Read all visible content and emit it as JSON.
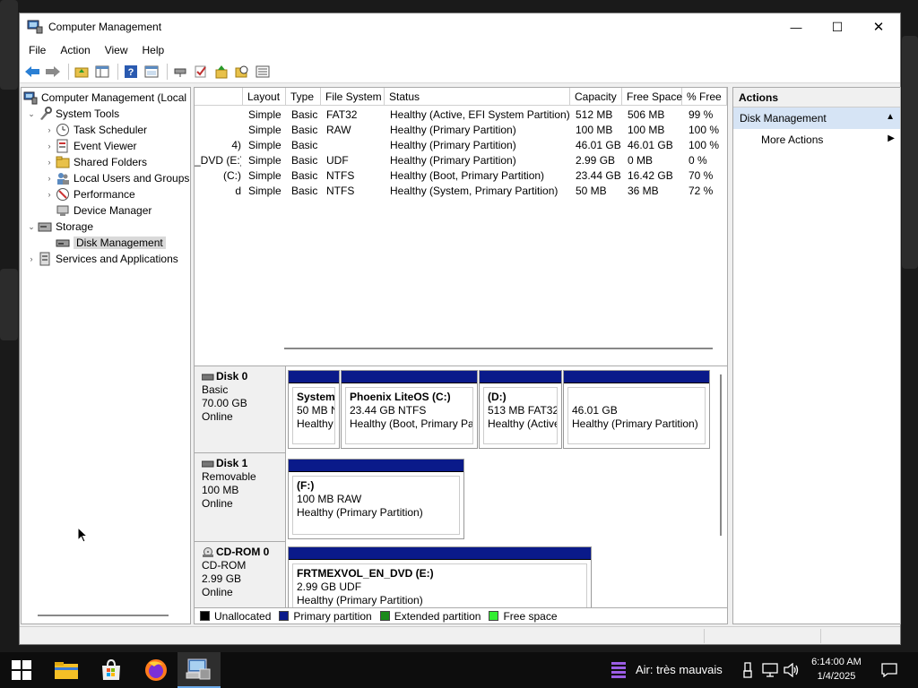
{
  "window": {
    "title": "Computer Management",
    "minimize_glyph": "—",
    "maximize_glyph": "☐",
    "close_glyph": "✕"
  },
  "menu": [
    "File",
    "Action",
    "View",
    "Help"
  ],
  "toolbar_icons": [
    "back-arrow-icon",
    "forward-arrow-icon",
    "up-folder-icon",
    "show-hide-tree-icon",
    "help-icon",
    "properties-icon",
    "connect-icon",
    "check-icon",
    "export-icon",
    "search-icon",
    "details-icon"
  ],
  "tree": {
    "root": "Computer Management (Local",
    "items": [
      {
        "label": "System Tools",
        "expanded": true,
        "level": 1
      },
      {
        "label": "Task Scheduler",
        "level": 2
      },
      {
        "label": "Event Viewer",
        "level": 2
      },
      {
        "label": "Shared Folders",
        "level": 2
      },
      {
        "label": "Local Users and Groups",
        "level": 2
      },
      {
        "label": "Performance",
        "level": 2
      },
      {
        "label": "Device Manager",
        "level": 2
      },
      {
        "label": "Storage",
        "expanded": true,
        "level": 1
      },
      {
        "label": "Disk Management",
        "level": 2,
        "selected": true
      },
      {
        "label": "Services and Applications",
        "level": 1
      }
    ]
  },
  "volume_table": {
    "columns": [
      "Layout",
      "Type",
      "File System",
      "Status",
      "Capacity",
      "Free Space",
      "% Free"
    ],
    "rows": [
      {
        "volume": "",
        "layout": "Simple",
        "type": "Basic",
        "fs": "FAT32",
        "status": "Healthy (Active, EFI System Partition)",
        "capacity": "512 MB",
        "free": "506 MB",
        "pct": "99 %"
      },
      {
        "volume": "",
        "layout": "Simple",
        "type": "Basic",
        "fs": "RAW",
        "status": "Healthy (Primary Partition)",
        "capacity": "100 MB",
        "free": "100 MB",
        "pct": "100 %"
      },
      {
        "volume": "4)",
        "layout": "Simple",
        "type": "Basic",
        "fs": "",
        "status": "Healthy (Primary Partition)",
        "capacity": "46.01 GB",
        "free": "46.01 GB",
        "pct": "100 %"
      },
      {
        "volume": "_DVD (E:)",
        "layout": "Simple",
        "type": "Basic",
        "fs": "UDF",
        "status": "Healthy (Primary Partition)",
        "capacity": "2.99 GB",
        "free": "0 MB",
        "pct": "0 %"
      },
      {
        "volume": "(C:)",
        "layout": "Simple",
        "type": "Basic",
        "fs": "NTFS",
        "status": "Healthy (Boot, Primary Partition)",
        "capacity": "23.44 GB",
        "free": "16.42 GB",
        "pct": "70 %"
      },
      {
        "volume": "d",
        "layout": "Simple",
        "type": "Basic",
        "fs": "NTFS",
        "status": "Healthy (System, Primary Partition)",
        "capacity": "50 MB",
        "free": "36 MB",
        "pct": "72 %"
      }
    ]
  },
  "disks": [
    {
      "name": "Disk 0",
      "kind": "Basic",
      "size": "70.00 GB",
      "state": "Online",
      "volumes": [
        {
          "name": "System",
          "line1": "50 MB N",
          "line2": "Healthy"
        },
        {
          "name": "Phoenix LiteOS  (C:)",
          "line1": "23.44 GB NTFS",
          "line2": "Healthy (Boot, Primary Pa"
        },
        {
          "name": " (D:)",
          "line1": "513 MB FAT32",
          "line2": "Healthy (Active"
        },
        {
          "name": "",
          "line1": "46.01 GB",
          "line2": "Healthy (Primary Partition)"
        }
      ]
    },
    {
      "name": "Disk 1",
      "kind": "Removable",
      "size": "100 MB",
      "state": "Online",
      "volumes": [
        {
          "name": " (F:)",
          "line1": "100 MB RAW",
          "line2": "Healthy (Primary Partition)"
        }
      ]
    },
    {
      "name": "CD-ROM 0",
      "kind": "CD-ROM",
      "size": "2.99 GB",
      "state": "Online",
      "volumes": [
        {
          "name": "FRTMEXVOL_EN_DVD  (E:)",
          "line1": "2.99 GB UDF",
          "line2": "Healthy (Primary Partition)"
        }
      ]
    }
  ],
  "legend": [
    {
      "label": "Unallocated",
      "color": "#000000"
    },
    {
      "label": "Primary partition",
      "color": "#0a1a8a"
    },
    {
      "label": "Extended partition",
      "color": "#1a8a1a"
    },
    {
      "label": "Free space",
      "color": "#33ee33"
    }
  ],
  "actions": {
    "header": "Actions",
    "section": "Disk Management",
    "section_caret": "▲",
    "item": "More Actions",
    "item_caret": "▶"
  },
  "taskbar": {
    "pinned": [
      "windows-start-icon",
      "file-explorer-icon",
      "microsoft-store-icon",
      "firefox-icon",
      "computer-management-icon"
    ],
    "weather": "Air: très mauvais",
    "time": "6:14:00 AM",
    "date": "1/4/2025"
  }
}
